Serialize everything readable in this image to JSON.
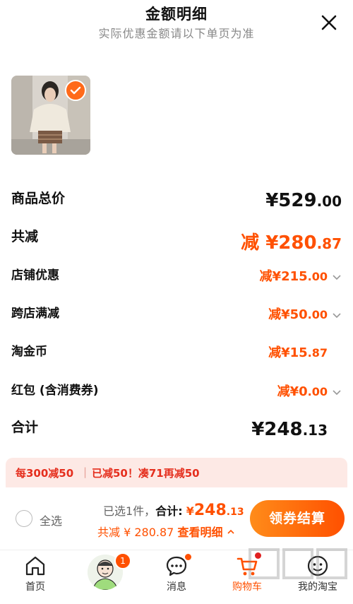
{
  "header": {
    "title": "金额明细",
    "subtitle": "实际优惠金额请以下单页为准"
  },
  "summary": {
    "goods_total": {
      "label": "商品总价",
      "yen": "¥",
      "int": "529",
      "dec": ".00"
    },
    "total_reduce": {
      "label": "共减",
      "prefix": "减",
      "yen": "¥",
      "int": "280",
      "dec": ".87"
    },
    "shop_discount": {
      "label": "店铺优惠",
      "prefix": "减",
      "yen": "¥",
      "int": "215",
      "dec": ".00"
    },
    "cross_store": {
      "label": "跨店满减",
      "prefix": "减",
      "yen": "¥",
      "int": "50",
      "dec": ".00"
    },
    "taojinbi": {
      "label": "淘金币",
      "prefix": "减",
      "yen": "¥",
      "int": "15",
      "dec": ".87"
    },
    "red_packet": {
      "label": "红包 (含消费券)",
      "prefix": "减",
      "yen": "¥",
      "int": "0",
      "dec": ".00"
    },
    "final_total": {
      "label": "合计",
      "yen": "¥",
      "int": "248",
      "dec": ".13"
    }
  },
  "promo": {
    "part1": "每300减50",
    "part2": "已减50！凑71再减50"
  },
  "checkout": {
    "select_all": "全选",
    "selected_prefix": "已选1件，",
    "total_label": "合计:",
    "total_yen": "¥",
    "total_int": "248",
    "total_dec": ".13",
    "reduce_text": "共减 ¥ 280.87",
    "detail_link": "查看明细",
    "pay_button": "领券结算"
  },
  "tabbar": {
    "items": [
      {
        "label": "首页",
        "icon": "home-icon"
      },
      {
        "label": "",
        "icon": "avatar-icon",
        "badge": "1"
      },
      {
        "label": "消息",
        "icon": "message-icon"
      },
      {
        "label": "购物车",
        "icon": "cart-icon"
      },
      {
        "label": "我的淘宝",
        "icon": "profile-icon"
      }
    ]
  },
  "colors": {
    "accent": "#ff5000",
    "promo_bg": "#fde9e5"
  }
}
